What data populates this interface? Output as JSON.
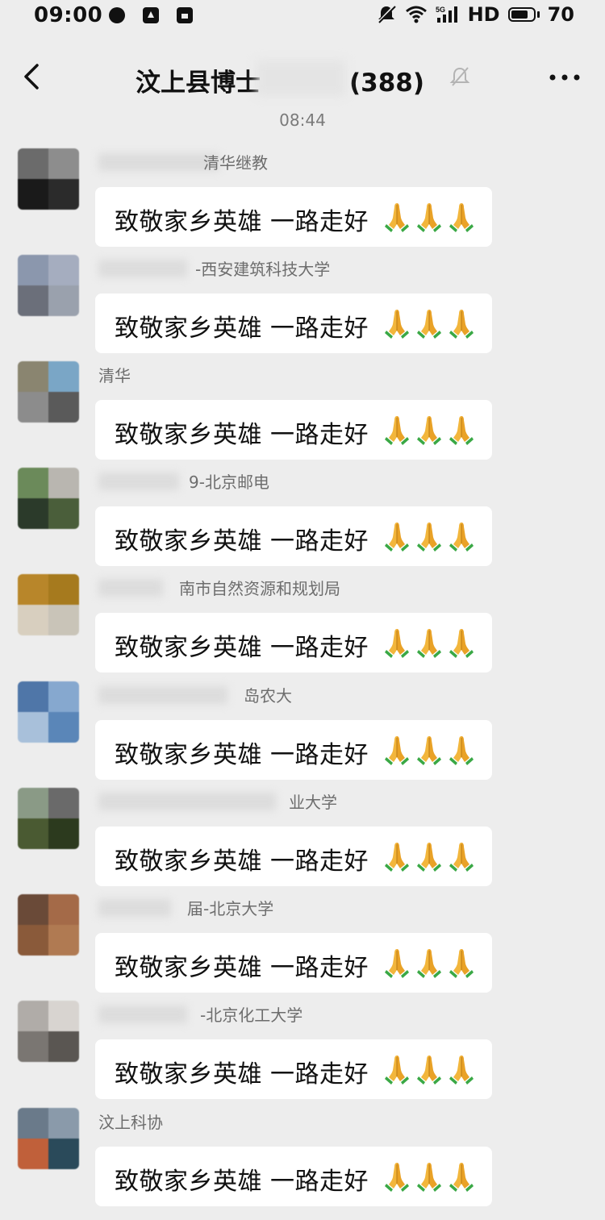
{
  "status_bar": {
    "time": "09:00",
    "network": "HD",
    "battery": "70",
    "signal_label": "5G"
  },
  "header": {
    "title": "汶上县博士",
    "title_suffix": "(388)",
    "timestamp": "08:44"
  },
  "messages": [
    {
      "sender": "清华继教",
      "text": "致敬家乡英雄 一路走好",
      "avatar_colors": [
        "#6b6b6b",
        "#8d8d8d",
        "#1a1a1a",
        "#2b2b2b"
      ]
    },
    {
      "sender": "-西安建筑科技大学",
      "text": "致敬家乡英雄 一路走好",
      "avatar_colors": [
        "#8b97ad",
        "#a5adbf",
        "#6b6f7a",
        "#9aa1ad"
      ]
    },
    {
      "sender": "清华",
      "text": "致敬家乡英雄 一路走好",
      "avatar_colors": [
        "#8a8570",
        "#7aa6c6",
        "#8c8c8c",
        "#5a5a5a"
      ]
    },
    {
      "sender": "9-北京邮电",
      "text": "致敬家乡英雄 一路走好",
      "avatar_colors": [
        "#6b8a5a",
        "#b9b6b0",
        "#2b3a2a",
        "#4a5e3a"
      ]
    },
    {
      "sender": "南市自然资源和规划局",
      "text": "致敬家乡英雄 一路走好",
      "avatar_colors": [
        "#b8862a",
        "#a67a1e",
        "#d8cfbf",
        "#c9c4b8"
      ]
    },
    {
      "sender": "岛农大",
      "text": "致敬家乡英雄 一路走好",
      "avatar_colors": [
        "#4f76a8",
        "#86a8cf",
        "#a8c0da",
        "#5a86b8"
      ]
    },
    {
      "sender": "业大学",
      "text": "致敬家乡英雄 一路走好",
      "avatar_colors": [
        "#8a9a86",
        "#6a6a6a",
        "#4a5a32",
        "#2c3a1e"
      ]
    },
    {
      "sender": "届-北京大学",
      "text": "致敬家乡英雄 一路走好",
      "avatar_colors": [
        "#6a4a38",
        "#a46a48",
        "#8a5a3a",
        "#b07a52"
      ]
    },
    {
      "sender": "-北京化工大学",
      "text": "致敬家乡英雄 一路走好",
      "avatar_colors": [
        "#b0aca8",
        "#d8d4d0",
        "#7a7672",
        "#5a5652"
      ]
    },
    {
      "sender": "汶上科协",
      "text": "致敬家乡英雄 一路走好",
      "avatar_colors": [
        "#6a7a8a",
        "#8a9aaa",
        "#c0603a",
        "#2a4a5a"
      ]
    }
  ],
  "icons": {
    "back": "back-arrow-icon",
    "mute": "bell-muted-icon",
    "more": "more-dots-icon",
    "emoji": "folded-hands-emoji"
  }
}
